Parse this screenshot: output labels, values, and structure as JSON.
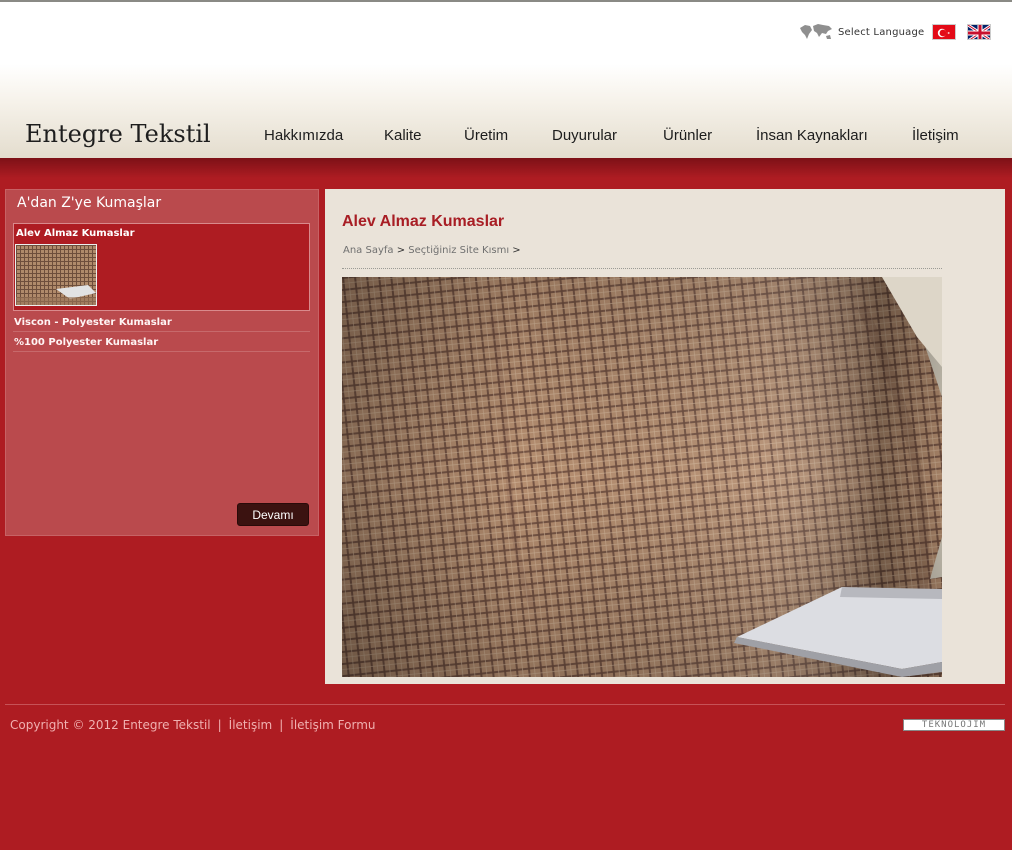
{
  "header": {
    "logo": "Entegre Tekstil",
    "language_label": "Select Language",
    "nav": [
      "Hakkımızda",
      "Kalite",
      "Üretim",
      "Duyurular",
      "Ürünler",
      "İnsan Kaynakları",
      "İletişim"
    ]
  },
  "sidebar": {
    "title": "A'dan Z'ye Kumaşlar",
    "featured_title": "Alev Almaz Kumaslar",
    "items": [
      "Viscon - Polyester Kumaslar",
      "%100 Polyester Kumaslar"
    ],
    "more_button": "Devamı"
  },
  "content": {
    "title": "Alev Almaz Kumaslar",
    "breadcrumb": {
      "home": "Ana Sayfa",
      "section": "Seçtiğiniz Site Kısmı",
      "separator": ">"
    }
  },
  "footer": {
    "copyright": "Copyright © 2012 Entegre Tekstil",
    "links": [
      "İletişim",
      "İletişim Formu"
    ],
    "separator": "|",
    "brand": "TEKNOLOJIM"
  },
  "colors": {
    "background": "#ae1c22",
    "panel": "#ba4a4d",
    "content": "#eae3d9",
    "title_red": "#a81d24"
  }
}
